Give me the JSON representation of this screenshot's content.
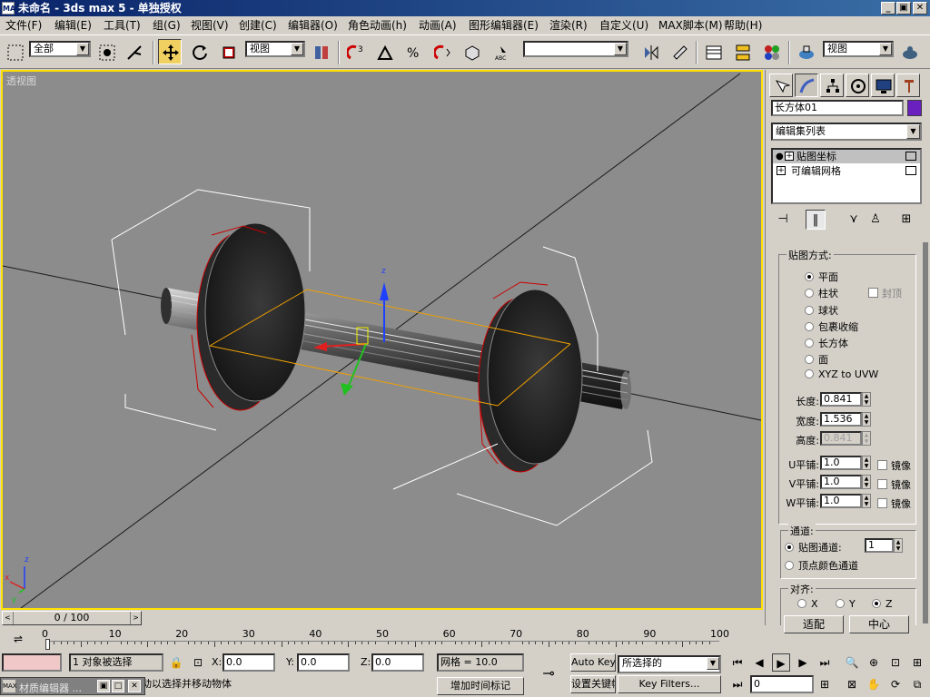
{
  "window": {
    "title": "未命名 - 3ds max 5 - 单独授权",
    "app_icon": "MAX",
    "min": "_",
    "max": "▣",
    "close": "✕"
  },
  "menu": [
    "文件(F)",
    "编辑(E)",
    "工具(T)",
    "组(G)",
    "视图(V)",
    "创建(C)",
    "编辑器(O)",
    "角色动画(h)",
    "动画(A)",
    "图形编辑器(E)",
    "渲染(R)",
    "自定义(U)",
    "MAX脚本(M)",
    "帮助(H)"
  ],
  "toolbar": {
    "selection_filter": "全部",
    "ref_coord": "视图",
    "named_selection": "",
    "render_viewport": "视图",
    "combo_arrow": "▼"
  },
  "viewport": {
    "label": "透视图",
    "border_color": "#ffe000",
    "background": "#8c8c8c",
    "gizmo_axis_z": "z",
    "corner_axes": {
      "x": "x",
      "y": "y",
      "z": "z"
    }
  },
  "command_panel": {
    "object_name": "长方体01",
    "object_color": "#6a1fbf",
    "modifier_list": "编辑集列表",
    "stack": [
      {
        "label": "贴图坐标",
        "selected": true,
        "expand": "+"
      },
      {
        "label": "可编辑网格",
        "selected": false,
        "expand": "+"
      }
    ],
    "mapping": {
      "title": "贴图方式:",
      "options": [
        "平面",
        "柱状",
        "球状",
        "包裹收缩",
        "长方体",
        "面",
        "XYZ to UVW"
      ],
      "selected": "平面",
      "cap_label": "封顶",
      "length_label": "长度:",
      "length": "0.841",
      "width_label": "宽度:",
      "width": "1.536",
      "height_label": "高度:",
      "height": "0.841",
      "u_tile_label": "U平铺:",
      "u_tile": "1.0",
      "v_tile_label": "V平铺:",
      "v_tile": "1.0",
      "w_tile_label": "W平铺:",
      "w_tile": "1.0",
      "flip_label": "镜像"
    },
    "channel": {
      "title": "通道:",
      "map_channel_label": "贴图通道:",
      "map_channel": "1",
      "vertex_color_label": "顶点颜色通道"
    },
    "alignment": {
      "title": "对齐:",
      "axes": [
        "X",
        "Y",
        "Z"
      ],
      "selected": "Z",
      "fit_button": "适配",
      "center_button": "中心"
    }
  },
  "time_slider": {
    "label": "0 / 100",
    "prev": "<",
    "next": ">",
    "current": 0,
    "total": 100,
    "ticks": [
      "0",
      "10",
      "20",
      "30",
      "40",
      "50",
      "60",
      "70",
      "80",
      "90",
      "100"
    ]
  },
  "status": {
    "selection": "1 对象被选择",
    "x_label": "X:",
    "x": "0.0",
    "y_label": "Y:",
    "y": "0.0",
    "z_label": "Z:",
    "z": "0.0",
    "grid": "网格 = 10.0",
    "add_time_tag": "增加时间标记",
    "prompt": "单击并拖动以选择并移动物体",
    "auto_key": "Auto Key",
    "set_key": "设置关键帧",
    "selected_set": "所选择的",
    "key_filters": "Key Filters...",
    "frame": "0",
    "mini_window": "材质编辑器 ..."
  }
}
